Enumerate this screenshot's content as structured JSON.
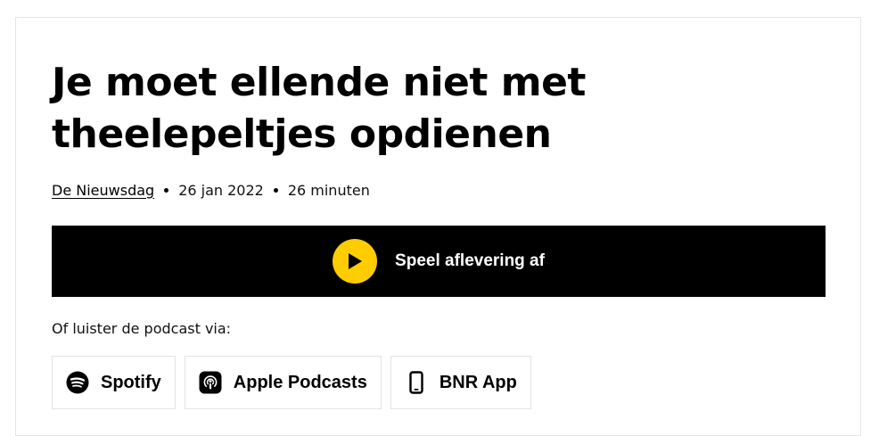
{
  "episode": {
    "title": "Je moet ellende niet met theelepeltjes opdienen",
    "show": "De Nieuwsdag",
    "date": "26 jan 2022",
    "duration": "26 minuten"
  },
  "player": {
    "play_label": "Speel aflevering af",
    "icon": "play-icon",
    "accent_color": "#ffcc00",
    "bar_color": "#000000"
  },
  "listen": {
    "intro": "Of luister de podcast via:",
    "platforms": [
      {
        "label": "Spotify",
        "icon": "spotify-icon"
      },
      {
        "label": "Apple Podcasts",
        "icon": "apple-podcasts-icon"
      },
      {
        "label": "BNR App",
        "icon": "phone-icon"
      }
    ]
  }
}
